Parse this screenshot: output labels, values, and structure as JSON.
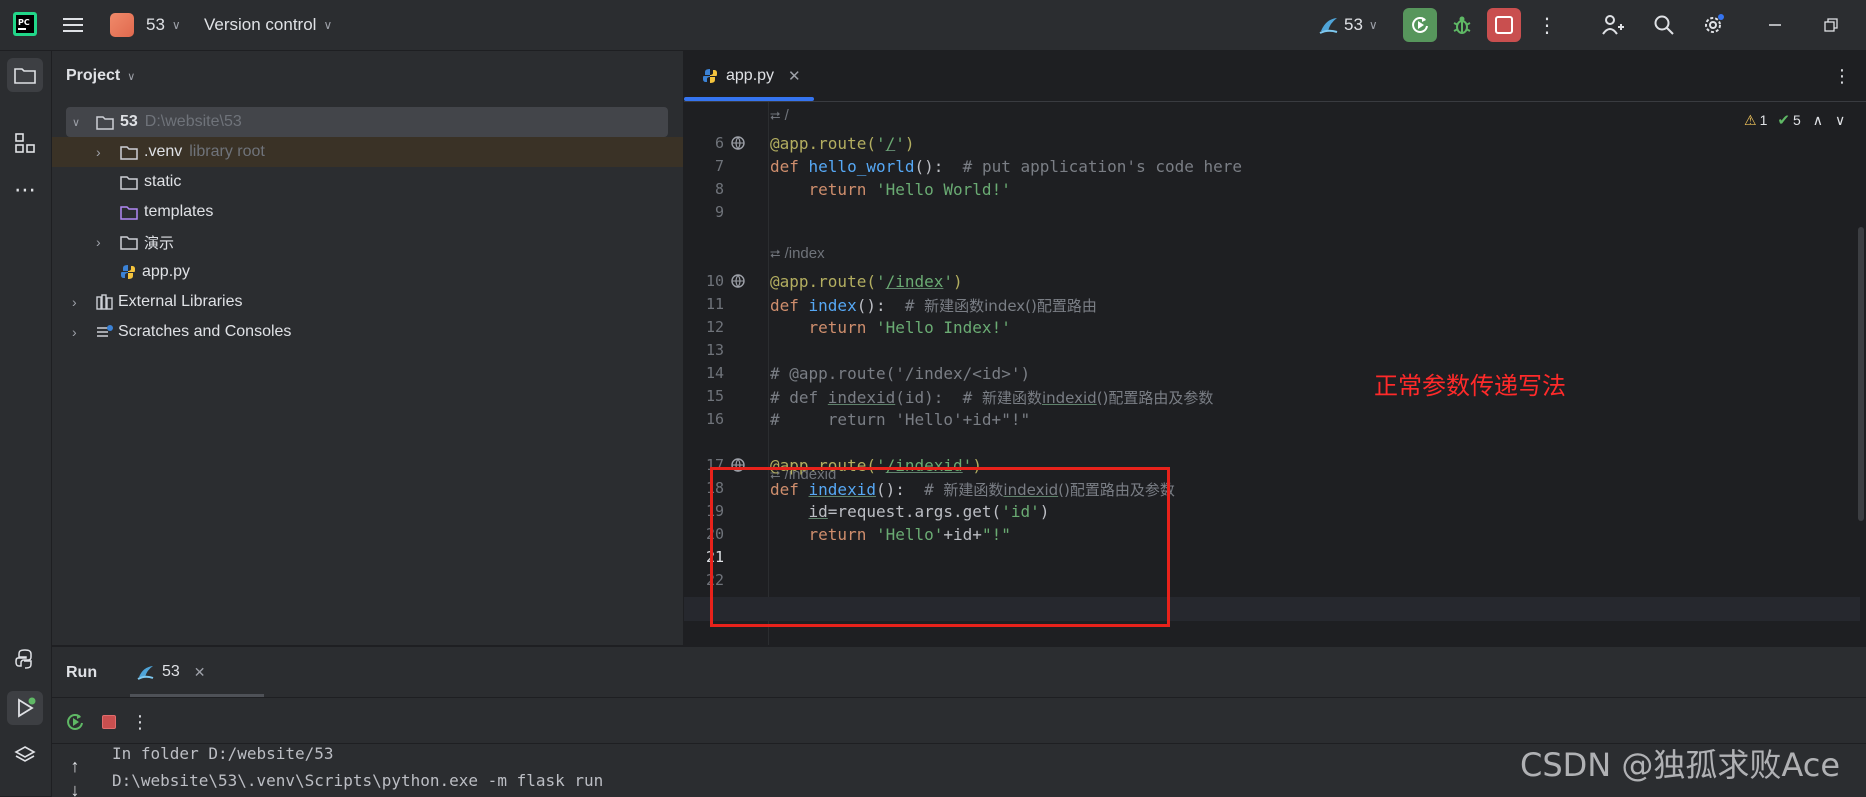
{
  "titlebar": {
    "project_badge": "53",
    "project_name": "53",
    "vcs_label": "Version control",
    "run_config": "53"
  },
  "toolstrip": {
    "icons": [
      "folder-icon",
      "structure-icon",
      "more-icon",
      "python-console-icon",
      "run-icon",
      "layers-icon"
    ]
  },
  "project_panel": {
    "title": "Project",
    "tree": [
      {
        "label": "53",
        "hint": "D:\\website\\53"
      },
      {
        "label": ".venv",
        "hint": "library root"
      },
      {
        "label": "static",
        "hint": ""
      },
      {
        "label": "templates",
        "hint": ""
      },
      {
        "label": "演示",
        "hint": ""
      },
      {
        "label": "app.py",
        "hint": ""
      },
      {
        "label": "External Libraries",
        "hint": ""
      },
      {
        "label": "Scratches and Consoles",
        "hint": ""
      }
    ]
  },
  "editor": {
    "tab_label": "app.py",
    "warnings_count": "1",
    "checks_count": "5",
    "route_hints": [
      "/",
      "/index",
      "/indexid"
    ],
    "line_numbers": [
      "6",
      "7",
      "8",
      "9",
      "10",
      "11",
      "12",
      "13",
      "14",
      "15",
      "16",
      "17",
      "18",
      "19",
      "20",
      "21",
      "22"
    ],
    "annotation": "正常参数传递写法",
    "colors": {
      "annotation": "#ff2a2a",
      "highlight_box": "#e8221b"
    }
  },
  "run_panel": {
    "title": "Run",
    "tab_label": "53",
    "output_lines": [
      "In folder D:/website/53",
      "D:\\website\\53\\.venv\\Scripts\\python.exe -m flask run"
    ]
  },
  "watermark": "CSDN @独孤求败Ace"
}
